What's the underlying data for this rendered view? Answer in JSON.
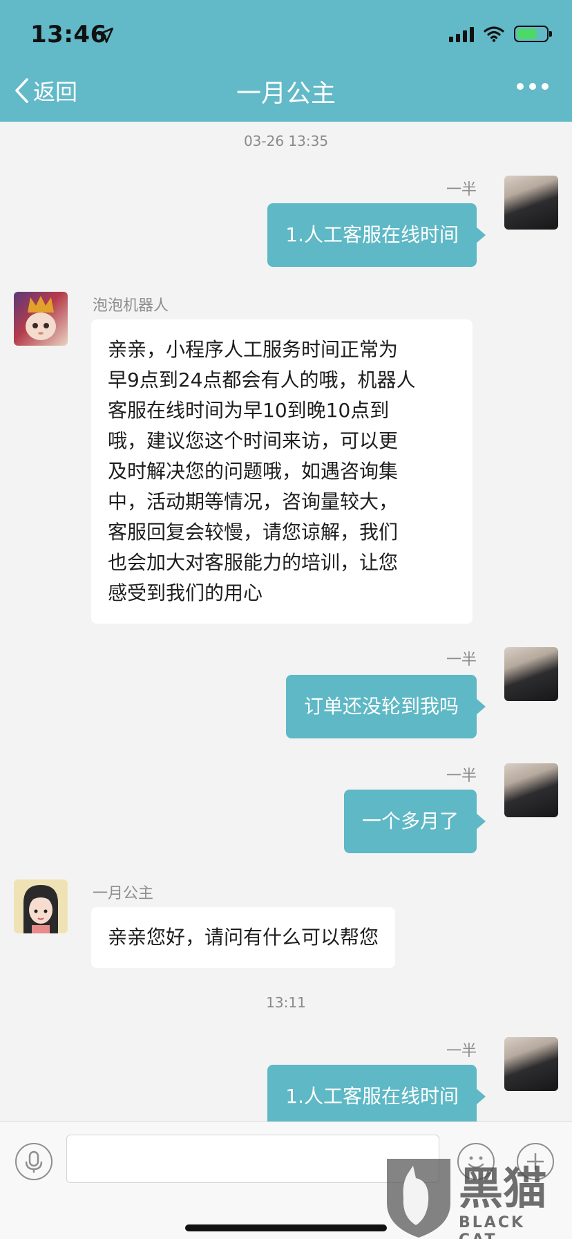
{
  "status_bar": {
    "time": "13:46",
    "location_icon": "location-arrow-icon",
    "battery_level": 0.7
  },
  "nav": {
    "back_label": "返回",
    "title": "一月公主",
    "more_icon": "more-dots-icon"
  },
  "messages": [
    {
      "type": "timestamp",
      "text": "03-26 13:35"
    },
    {
      "type": "out",
      "sender": "一半",
      "text": "1.人工客服在线时间"
    },
    {
      "type": "in",
      "sender": "泡泡机器人",
      "lines": [
        "亲亲，小程序人工服务时间正常为",
        "早9点到24点都会有人的哦，机器人",
        "客服在线时间为早10到晚10点到",
        "哦，建议您这个时间来访，可以更",
        "及时解决您的问题哦，如遇咨询集",
        "中，活动期等情况，咨询量较大，",
        "客服回复会较慢，请您谅解，我们",
        "也会加大对客服能力的培训，让您",
        "感受到我们的用心"
      ]
    },
    {
      "type": "out",
      "sender": "一半",
      "text": "订单还没轮到我吗"
    },
    {
      "type": "out",
      "sender": "一半",
      "text": "一个多月了"
    },
    {
      "type": "in",
      "sender": "一月公主",
      "text": "亲亲您好，请问有什么可以帮您"
    },
    {
      "type": "timestamp",
      "text": "13:11"
    },
    {
      "type": "out",
      "sender": "一半",
      "text": "1.人工客服在线时间"
    }
  ],
  "input_bar": {
    "mic_icon": "microphone-icon",
    "emoji_icon": "emoji-icon",
    "plus_icon": "plus-icon",
    "placeholder": ""
  },
  "watermark": {
    "cn": "黑猫",
    "en": "BLACK CAT"
  },
  "colors": {
    "header": "#62b9c7",
    "bubble_out": "#5eb8c5",
    "bubble_in": "#ffffff",
    "background": "#f3f3f3"
  }
}
